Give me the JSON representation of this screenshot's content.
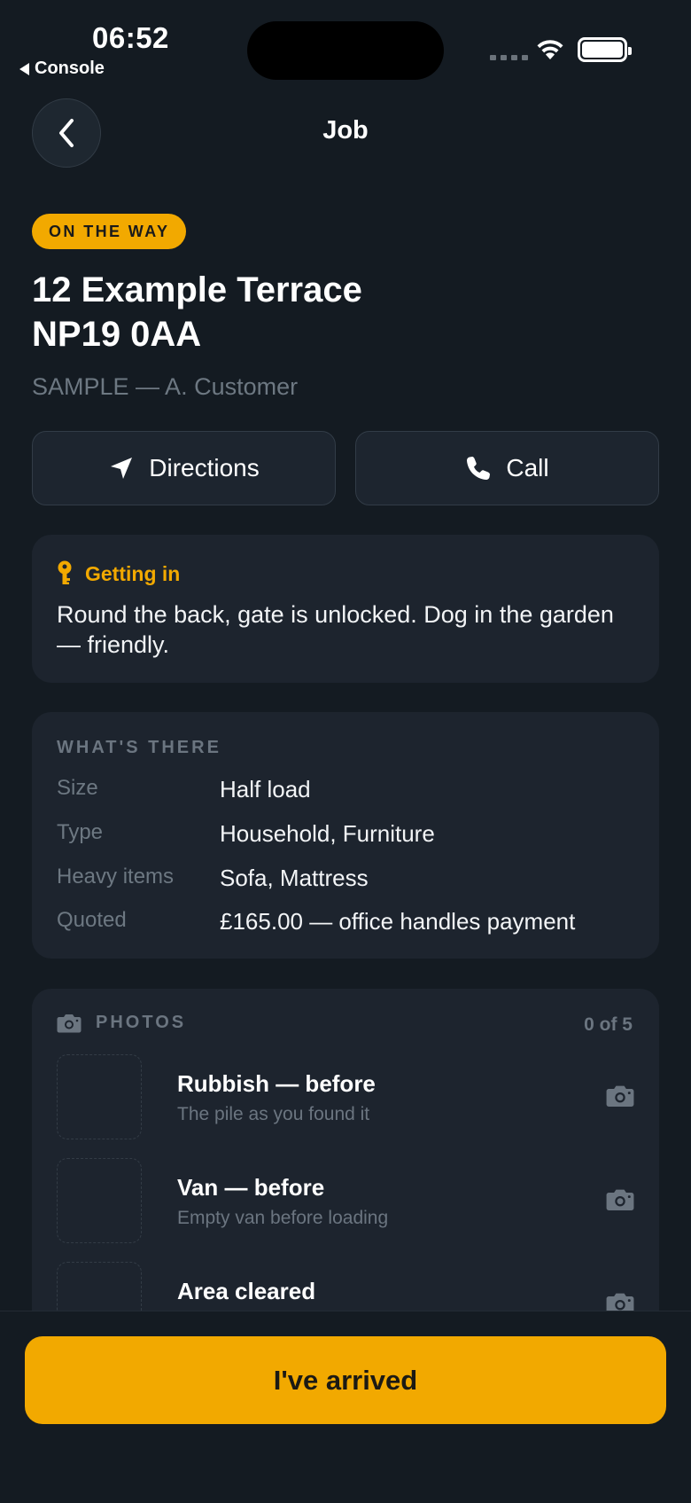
{
  "status_bar": {
    "time": "06:52",
    "back_app": "Console"
  },
  "nav": {
    "title": "Job"
  },
  "job": {
    "status_badge": "ON THE WAY",
    "address_line1": "12 Example Terrace",
    "address_line2": "NP19 0AA",
    "reference": "SAMPLE — A. Customer"
  },
  "actions": {
    "directions_label": "Directions",
    "call_label": "Call"
  },
  "getting_in": {
    "title": "Getting in",
    "body": "Round the back, gate is unlocked. Dog in the garden — friendly."
  },
  "whats_there": {
    "title": "WHAT'S THERE",
    "rows": [
      {
        "key": "Size",
        "value": "Half load"
      },
      {
        "key": "Type",
        "value": "Household, Furniture"
      },
      {
        "key": "Heavy items",
        "value": "Sofa, Mattress"
      },
      {
        "key": "Quoted",
        "value": "£165.00 — office handles payment"
      }
    ]
  },
  "photos": {
    "title": "PHOTOS",
    "count": "0 of 5",
    "items": [
      {
        "title": "Rubbish — before",
        "desc": "The pile as you found it"
      },
      {
        "title": "Van — before",
        "desc": "Empty van before loading"
      },
      {
        "title": "Area cleared",
        "desc": ""
      }
    ]
  },
  "primary_action": {
    "label": "I've arrived"
  },
  "colors": {
    "background": "#141b22",
    "card": "#1d242e",
    "accent": "#f2a900",
    "muted_text": "#6d7882"
  },
  "icons": [
    "chevron-left-icon",
    "navigation-arrow-icon",
    "phone-icon",
    "key-icon",
    "camera-icon",
    "wifi-icon",
    "battery-icon"
  ]
}
